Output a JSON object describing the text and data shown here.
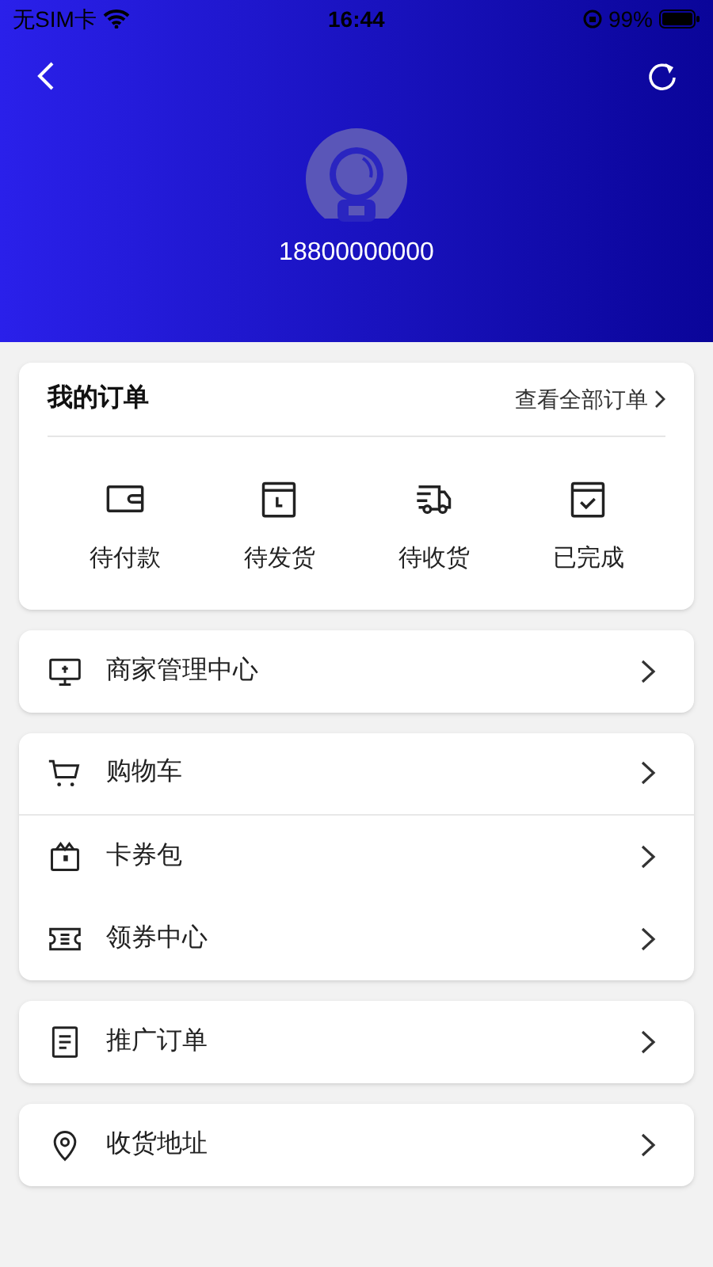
{
  "status_bar": {
    "carrier": "无SIM卡",
    "time": "16:44",
    "battery": "99%"
  },
  "header": {
    "phone": "18800000000"
  },
  "orders": {
    "title": "我的订单",
    "view_all": "查看全部订单",
    "items": [
      {
        "label": "待付款",
        "kind": "wallet"
      },
      {
        "label": "待发货",
        "kind": "clock"
      },
      {
        "label": "待收货",
        "kind": "truck"
      },
      {
        "label": "已完成",
        "kind": "check"
      }
    ]
  },
  "menu_groups": [
    [
      {
        "label": "商家管理中心",
        "kind": "monitor",
        "divider_below": false
      }
    ],
    [
      {
        "label": "购物车",
        "kind": "cart",
        "divider_below": true
      },
      {
        "label": "卡券包",
        "kind": "bag",
        "divider_below": false
      },
      {
        "label": "领券中心",
        "kind": "ticket",
        "divider_below": false
      }
    ],
    [
      {
        "label": "推广订单",
        "kind": "document",
        "divider_below": false
      }
    ],
    [
      {
        "label": "收货地址",
        "kind": "pin",
        "divider_below": false
      }
    ]
  ]
}
